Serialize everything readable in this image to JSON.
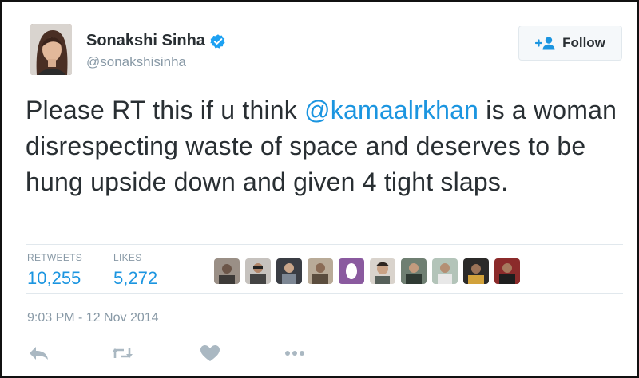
{
  "user": {
    "name": "Sonakshi Sinha",
    "handle": "@sonakshisinha"
  },
  "follow_button": {
    "label": "Follow"
  },
  "tweet": {
    "text_before": "Please RT this if u think ",
    "mention": "@kamaalrkhan",
    "text_after": " is a woman disrespecting waste of space and deserves to be hung upside down and given 4 tight slaps."
  },
  "stats": {
    "retweets_label": "RETWEETS",
    "retweets_value": "10,255",
    "likes_label": "LIKES",
    "likes_value": "5,272"
  },
  "likers_count_shown": 10,
  "timestamp": "9:03 PM - 12 Nov 2014",
  "icons": [
    "verified-icon",
    "follow-user-icon",
    "reply-icon",
    "retweet-icon",
    "like-icon",
    "more-icon"
  ],
  "colors": {
    "link": "#1b95e0",
    "muted": "#8899a6",
    "text": "#292f33",
    "divider": "#e1e8ed"
  }
}
